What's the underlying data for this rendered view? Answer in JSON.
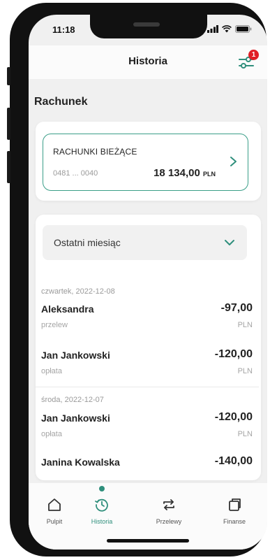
{
  "status_bar": {
    "time": "11:18"
  },
  "header": {
    "title": "Historia",
    "filter_badge": "1"
  },
  "section": {
    "label": "Rachunek"
  },
  "account": {
    "name": "RACHUNKI BIEŻĄCE",
    "number": "0481 ... 0040",
    "balance": "18 134,00",
    "currency": "PLN"
  },
  "filter": {
    "period_label": "Ostatni miesiąc"
  },
  "history": {
    "groups": [
      {
        "date": "czwartek, 2022-12-08",
        "transactions": [
          {
            "name": "Aleksandra",
            "type": "przelew",
            "amount": "-97,00",
            "currency": "PLN"
          },
          {
            "name": "Jan Jankowski",
            "type": "opłata",
            "amount": "-120,00",
            "currency": "PLN"
          }
        ]
      },
      {
        "date": "środa, 2022-12-07",
        "transactions": [
          {
            "name": "Jan Jankowski",
            "type": "opłata",
            "amount": "-120,00",
            "currency": "PLN"
          },
          {
            "name": "Janina Kowalska",
            "amount": "-140,00"
          }
        ]
      }
    ]
  },
  "nav": {
    "items": [
      {
        "label": "Pulpit",
        "icon": "home-icon"
      },
      {
        "label": "Historia",
        "icon": "history-icon",
        "active": true
      },
      {
        "label": "Przelewy",
        "icon": "transfer-icon"
      },
      {
        "label": "Finanse",
        "icon": "finance-icon"
      }
    ]
  },
  "colors": {
    "accent": "#2f8f7c",
    "account_border": "#3a9e88",
    "badge": "#e01f26",
    "background": "#f0f0f0"
  }
}
